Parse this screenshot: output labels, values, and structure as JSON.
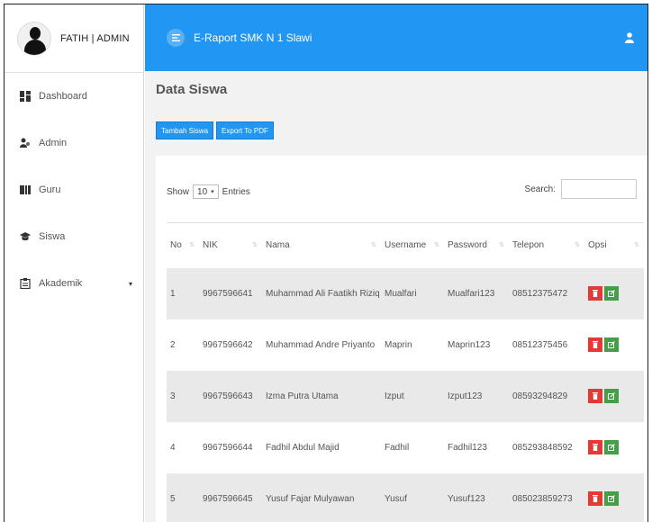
{
  "sidebar": {
    "brand": "FATIH | ADMIN",
    "items": [
      {
        "label": "Dashboard",
        "icon": "dashboard-icon"
      },
      {
        "label": "Admin",
        "icon": "users-icon"
      },
      {
        "label": "Guru",
        "icon": "teacher-icon"
      },
      {
        "label": "Siswa",
        "icon": "graduation-cap-icon"
      },
      {
        "label": "Akademik",
        "icon": "clipboard-icon",
        "caret": "▾"
      }
    ]
  },
  "topbar": {
    "title": "E-Raport SMK N 1 Slawi",
    "color": "#2196f3"
  },
  "main": {
    "title": "Data Siswa",
    "buttons": {
      "add": "Tambah Siswa",
      "export": "Export To PDF"
    },
    "show": "Show",
    "entries_value": "10",
    "entries": "Entries",
    "search": "Search:"
  },
  "table": {
    "columns": [
      "No",
      "NIK",
      "Nama",
      "Username",
      "Password",
      "Telepon",
      "Opsi"
    ],
    "rows": [
      {
        "no": "1",
        "nik": "9967596641",
        "nama": "Muhammad Ali Faatikh Riziq",
        "username": "Mualfari",
        "password": "Mualfari123",
        "telepon": "08512375472"
      },
      {
        "no": "2",
        "nik": "9967596642",
        "nama": "Muhammad Andre Priyanto",
        "username": "Maprin",
        "password": "Maprin123",
        "telepon": "08512375456"
      },
      {
        "no": "3",
        "nik": "9967596643",
        "nama": "Izma Putra Utama",
        "username": "Izput",
        "password": "Izput123",
        "telepon": "08593294829"
      },
      {
        "no": "4",
        "nik": "9967596644",
        "nama": "Fadhil Abdul Majid",
        "username": "Fadhil",
        "password": "Fadhil123",
        "telepon": "085293848592"
      },
      {
        "no": "5",
        "nik": "9967596645",
        "nama": "Yusuf Fajar Mulyawan",
        "username": "Yusuf",
        "password": "Yusuf123",
        "telepon": "085023859273"
      }
    ]
  }
}
